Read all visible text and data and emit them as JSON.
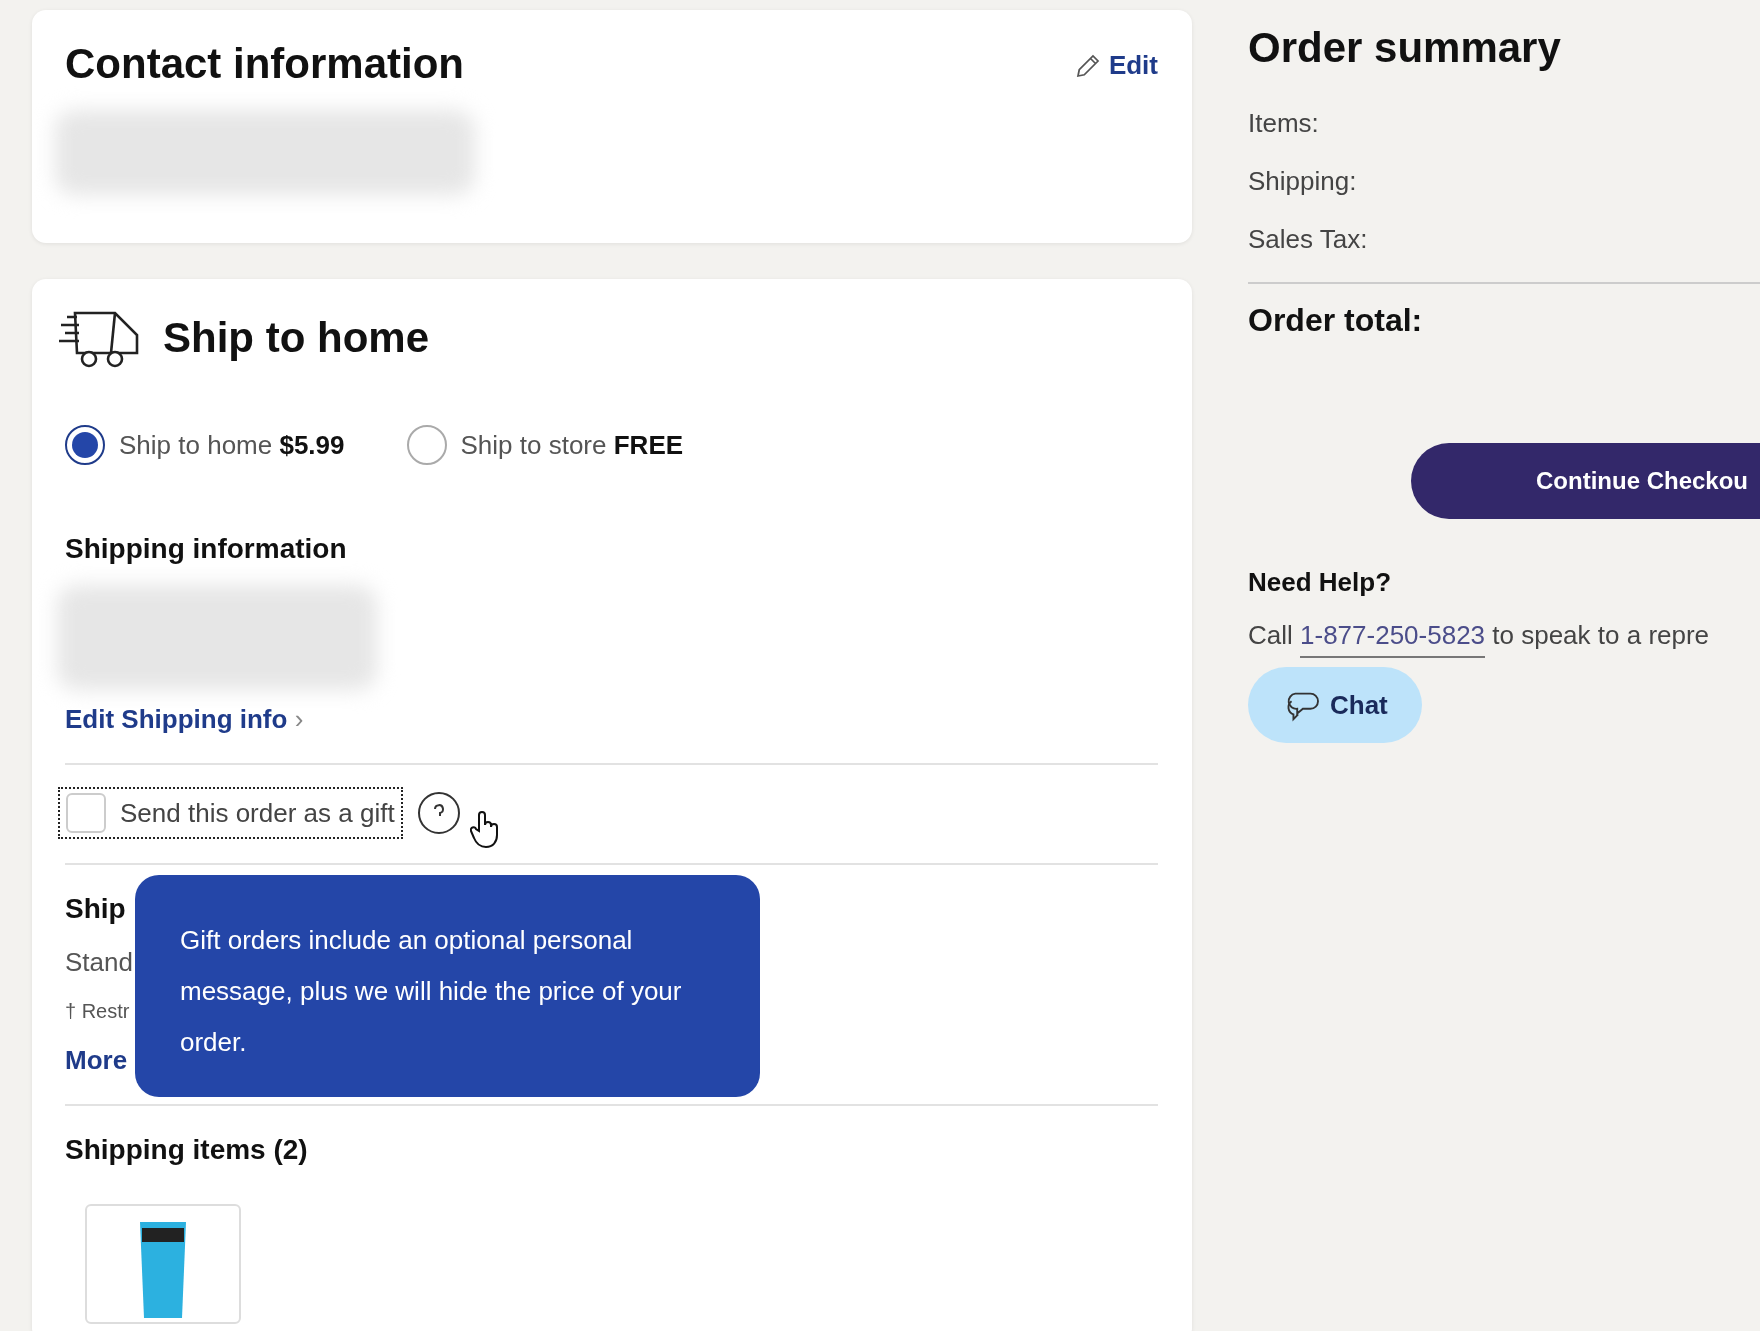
{
  "contact": {
    "title": "Contact information",
    "edit": "Edit"
  },
  "shipping": {
    "title": "Ship to home",
    "options": [
      {
        "label": "Ship to home",
        "price": "$5.99",
        "selected": true
      },
      {
        "label": "Ship to store",
        "price": "FREE",
        "selected": false
      }
    ],
    "info_title": "Shipping information",
    "edit_link": "Edit Shipping info",
    "edit_chevron": "›",
    "gift": {
      "label": "Send this order as a gift",
      "checked": false
    },
    "tooltip": "Gift orders include an optional personal message, plus we will hide the price of your order.",
    "method_title": "Ship",
    "method_text": "Stand",
    "restriction": "† Restr",
    "more_options": "More",
    "items_title": "Shipping items (2)"
  },
  "summary": {
    "title": "Order summary",
    "lines": [
      "Items:",
      "Shipping:",
      "Sales Tax:"
    ],
    "total": "Order total:",
    "button": "Continue Checkou",
    "help_title": "Need Help?",
    "call_prefix": "Call",
    "phone": "1-877-250-5823",
    "call_suffix": "to speak to a repre",
    "chat": "Chat"
  }
}
